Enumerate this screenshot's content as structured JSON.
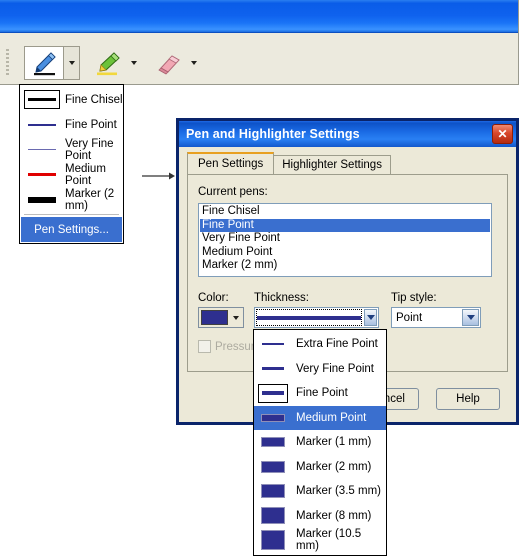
{
  "app": {
    "titlebar_color": "#0f62ee",
    "toolbar": {
      "tools": [
        {
          "name": "pen-tool",
          "icon": "pen-icon",
          "pressed": true
        },
        {
          "name": "highlighter-tool",
          "icon": "highlighter-icon",
          "pressed": false
        },
        {
          "name": "eraser-tool",
          "icon": "eraser-icon",
          "pressed": false
        }
      ]
    }
  },
  "pen_menu": {
    "items": [
      {
        "label": "Fine Chisel",
        "color": "#000000",
        "thickness": 3,
        "boxed": true
      },
      {
        "label": "Fine Point",
        "color": "#2e2f8f",
        "thickness": 2,
        "boxed": false
      },
      {
        "label": "Very Fine Point",
        "color": "#6a6ab0",
        "thickness": 1,
        "boxed": false
      },
      {
        "label": "Medium Point",
        "color": "#e00000",
        "thickness": 3,
        "boxed": false
      },
      {
        "label": "Marker (2 mm)",
        "color": "#000000",
        "thickness": 6,
        "boxed": false
      }
    ],
    "settings_label": "Pen Settings..."
  },
  "dialog": {
    "title": "Pen and Highlighter Settings",
    "close_label": "✕",
    "tabs": [
      {
        "label": "Pen Settings",
        "active": true
      },
      {
        "label": "Highlighter Settings",
        "active": false
      }
    ],
    "current_pens_label": "Current pens:",
    "pens": [
      {
        "label": "Fine Chisel",
        "selected": false
      },
      {
        "label": "Fine Point",
        "selected": true
      },
      {
        "label": "Very Fine Point",
        "selected": false
      },
      {
        "label": "Medium Point",
        "selected": false
      },
      {
        "label": "Marker (2 mm)",
        "selected": false
      }
    ],
    "color_label": "Color:",
    "color_value": "#2e2f8f",
    "thickness_label": "Thickness:",
    "thickness_value_color": "#2e2f8f",
    "tip_style_label": "Tip style:",
    "tip_style_value": "Point",
    "pressure_label": "Pressure",
    "pressure_checked": false,
    "buttons": [
      {
        "name": "cancel-button",
        "label": "Cancel"
      },
      {
        "name": "help-button",
        "label": "Help"
      }
    ]
  },
  "thickness_dropdown": {
    "items": [
      {
        "label": "Extra Fine Point",
        "height": 2,
        "selected": false,
        "boxed": false
      },
      {
        "label": "Very Fine Point",
        "height": 3,
        "selected": false,
        "boxed": false
      },
      {
        "label": "Fine Point",
        "height": 4,
        "selected": false,
        "boxed": true
      },
      {
        "label": "Medium Point",
        "height": 6,
        "selected": true,
        "boxed": false
      },
      {
        "label": "Marker (1 mm)",
        "height": 8,
        "selected": false,
        "boxed": false
      },
      {
        "label": "Marker (2 mm)",
        "height": 10,
        "selected": false,
        "boxed": false
      },
      {
        "label": "Marker (3.5 mm)",
        "height": 12,
        "selected": false,
        "boxed": false
      },
      {
        "label": "Marker (8 mm)",
        "height": 15,
        "selected": false,
        "boxed": false
      },
      {
        "label": "Marker (10.5 mm)",
        "height": 18,
        "selected": false,
        "boxed": false
      }
    ]
  }
}
